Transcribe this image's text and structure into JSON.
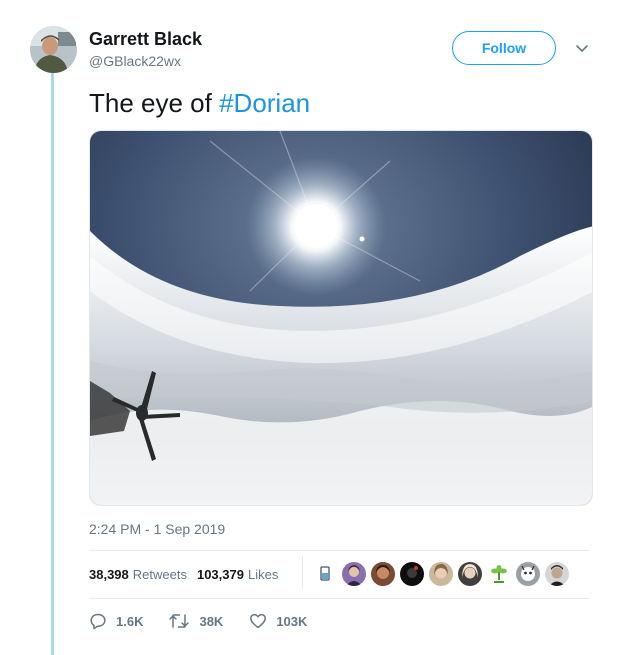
{
  "author": {
    "display_name": "Garrett Black",
    "handle": "@GBlack22wx",
    "avatar_icon": "user-avatar"
  },
  "header": {
    "follow_label": "Follow",
    "menu_icon": "chevron-down-icon"
  },
  "tweet": {
    "text_prefix": "The eye of ",
    "hashtag": "#Dorian",
    "timestamp": "2:24 PM - 1 Sep 2019"
  },
  "stats": {
    "retweets_count": "38,398",
    "retweets_label": "Retweets",
    "likes_count": "103,379",
    "likes_label": "Likes"
  },
  "actions": {
    "reply_count": "1.6K",
    "retweet_count": "38K",
    "like_count": "103K"
  },
  "colors": {
    "accent": "#1da1f2",
    "hashtag": "#1b95e0",
    "thread_line": "#a6dce3",
    "muted_text": "#657786"
  }
}
